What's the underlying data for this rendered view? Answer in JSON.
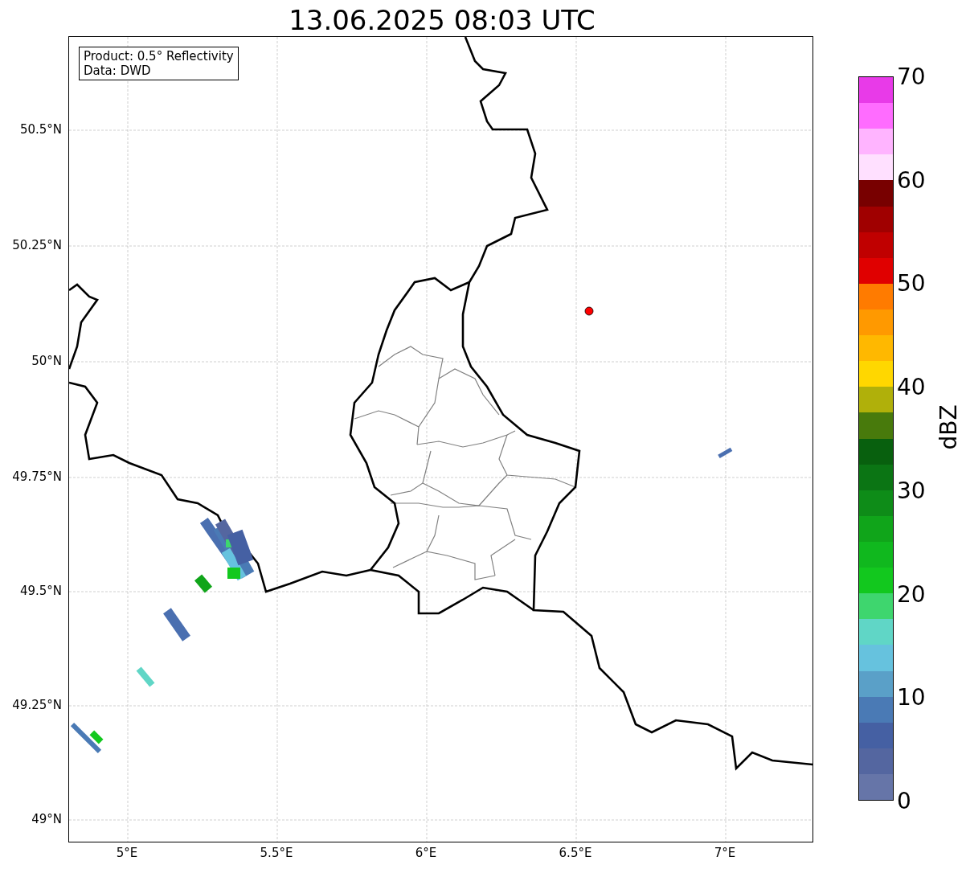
{
  "title": "13.06.2025 08:03 UTC",
  "info_box": [
    "Product: 0.5° Reflectivity",
    "Data: DWD"
  ],
  "map": {
    "latitude_ticks": [
      "50.5°N",
      "50.25°N",
      "50°N",
      "49.75°N",
      "49.5°N",
      "49.25°N",
      "49°N"
    ],
    "longitude_ticks": [
      "5°E",
      "5.5°E",
      "6°E",
      "6.5°E",
      "7°E"
    ]
  },
  "colorbar": {
    "label": "dBZ",
    "ticks": [
      "70",
      "60",
      "50",
      "40",
      "30",
      "20",
      "10",
      "0"
    ],
    "bands": [
      {
        "color": "#6675a8"
      },
      {
        "color": "#5466a0"
      },
      {
        "color": "#4560a3"
      },
      {
        "color": "#4a7ab5"
      },
      {
        "color": "#5aa0c8"
      },
      {
        "color": "#66c2de"
      },
      {
        "color": "#60d6c6"
      },
      {
        "color": "#3ed66e"
      },
      {
        "color": "#12c81e"
      },
      {
        "color": "#10b81e"
      },
      {
        "color": "#10a51a"
      },
      {
        "color": "#0e8c18"
      },
      {
        "color": "#0b7514"
      },
      {
        "color": "#08600e"
      },
      {
        "color": "#487a0c"
      },
      {
        "color": "#b0b00a"
      },
      {
        "color": "#ffd700"
      },
      {
        "color": "#ffb800"
      },
      {
        "color": "#ff9900"
      },
      {
        "color": "#ff7b00"
      },
      {
        "color": "#e00000"
      },
      {
        "color": "#c00000"
      },
      {
        "color": "#a00000"
      },
      {
        "color": "#780000"
      },
      {
        "color": "#ffe0ff"
      },
      {
        "color": "#ffb4ff"
      },
      {
        "color": "#ff6cff"
      },
      {
        "color": "#e83ae8"
      }
    ]
  }
}
